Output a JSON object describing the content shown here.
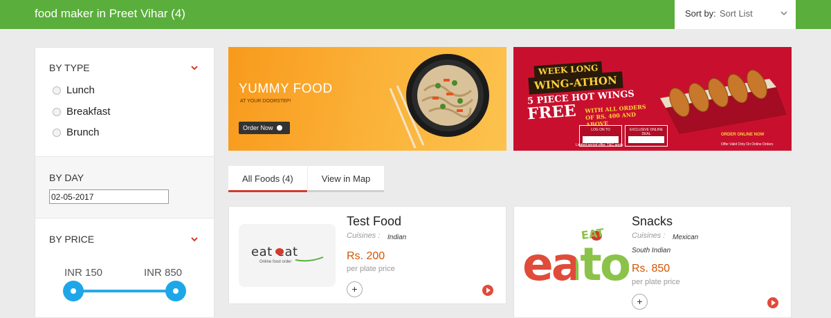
{
  "header": {
    "title": "food maker in Preet Vihar (4)",
    "sort_label": "Sort by:",
    "sort_value": "Sort List",
    "bg_color": "#5aae3c"
  },
  "filters": {
    "type": {
      "title": "BY TYPE",
      "options": [
        "Lunch",
        "Breakfast",
        "Brunch"
      ]
    },
    "day": {
      "title": "BY DAY",
      "date_value": "02-05-2017"
    },
    "price": {
      "title": "BY PRICE",
      "min_label": "INR 150",
      "max_label": "INR 850",
      "slider_color": "#1ea7e8"
    }
  },
  "banners": [
    {
      "title": "YUMMY FOOD",
      "subtitle": "AT YOUR DOORSTEP!",
      "button": "Order Now"
    },
    {
      "line1": "WEEK LONG",
      "line2": "WING-ATHON",
      "line3": "5 PIECE HOT WINGS",
      "line4": "FREE",
      "line5": "WITH ALL ORDERS OF RS. 400 AND ABOVE",
      "box1": "LOG ON TO",
      "box2": "EXCLUSIVE ONLINE DEAL",
      "order_online": "ORDER ONLINE NOW",
      "offer_note": "Offer Valid Only On Online Orders",
      "terms": "Limited period offer. T&C apply."
    }
  ],
  "tabs": [
    {
      "label": "All Foods (4)",
      "active": true
    },
    {
      "label": "View in Map",
      "active": false
    }
  ],
  "cards": [
    {
      "title": "Test Food",
      "cuisines_label": "Cuisines :",
      "cuisines": [
        "Indian"
      ],
      "price": "Rs. 200",
      "per_plate": "per plate price",
      "logo_text": "eat eat",
      "logo_sub": "Online food order"
    },
    {
      "title": "Snacks",
      "cuisines_label": "Cuisines :",
      "cuisines": [
        "Mexican",
        "South Indian"
      ],
      "price": "Rs. 850",
      "per_plate": "per plate price",
      "logo_text": "eato",
      "logo_small": "EAT"
    }
  ],
  "colors": {
    "accent_red": "#d33a2c",
    "price_orange": "#d35400",
    "banner2_red": "#c8102e"
  }
}
